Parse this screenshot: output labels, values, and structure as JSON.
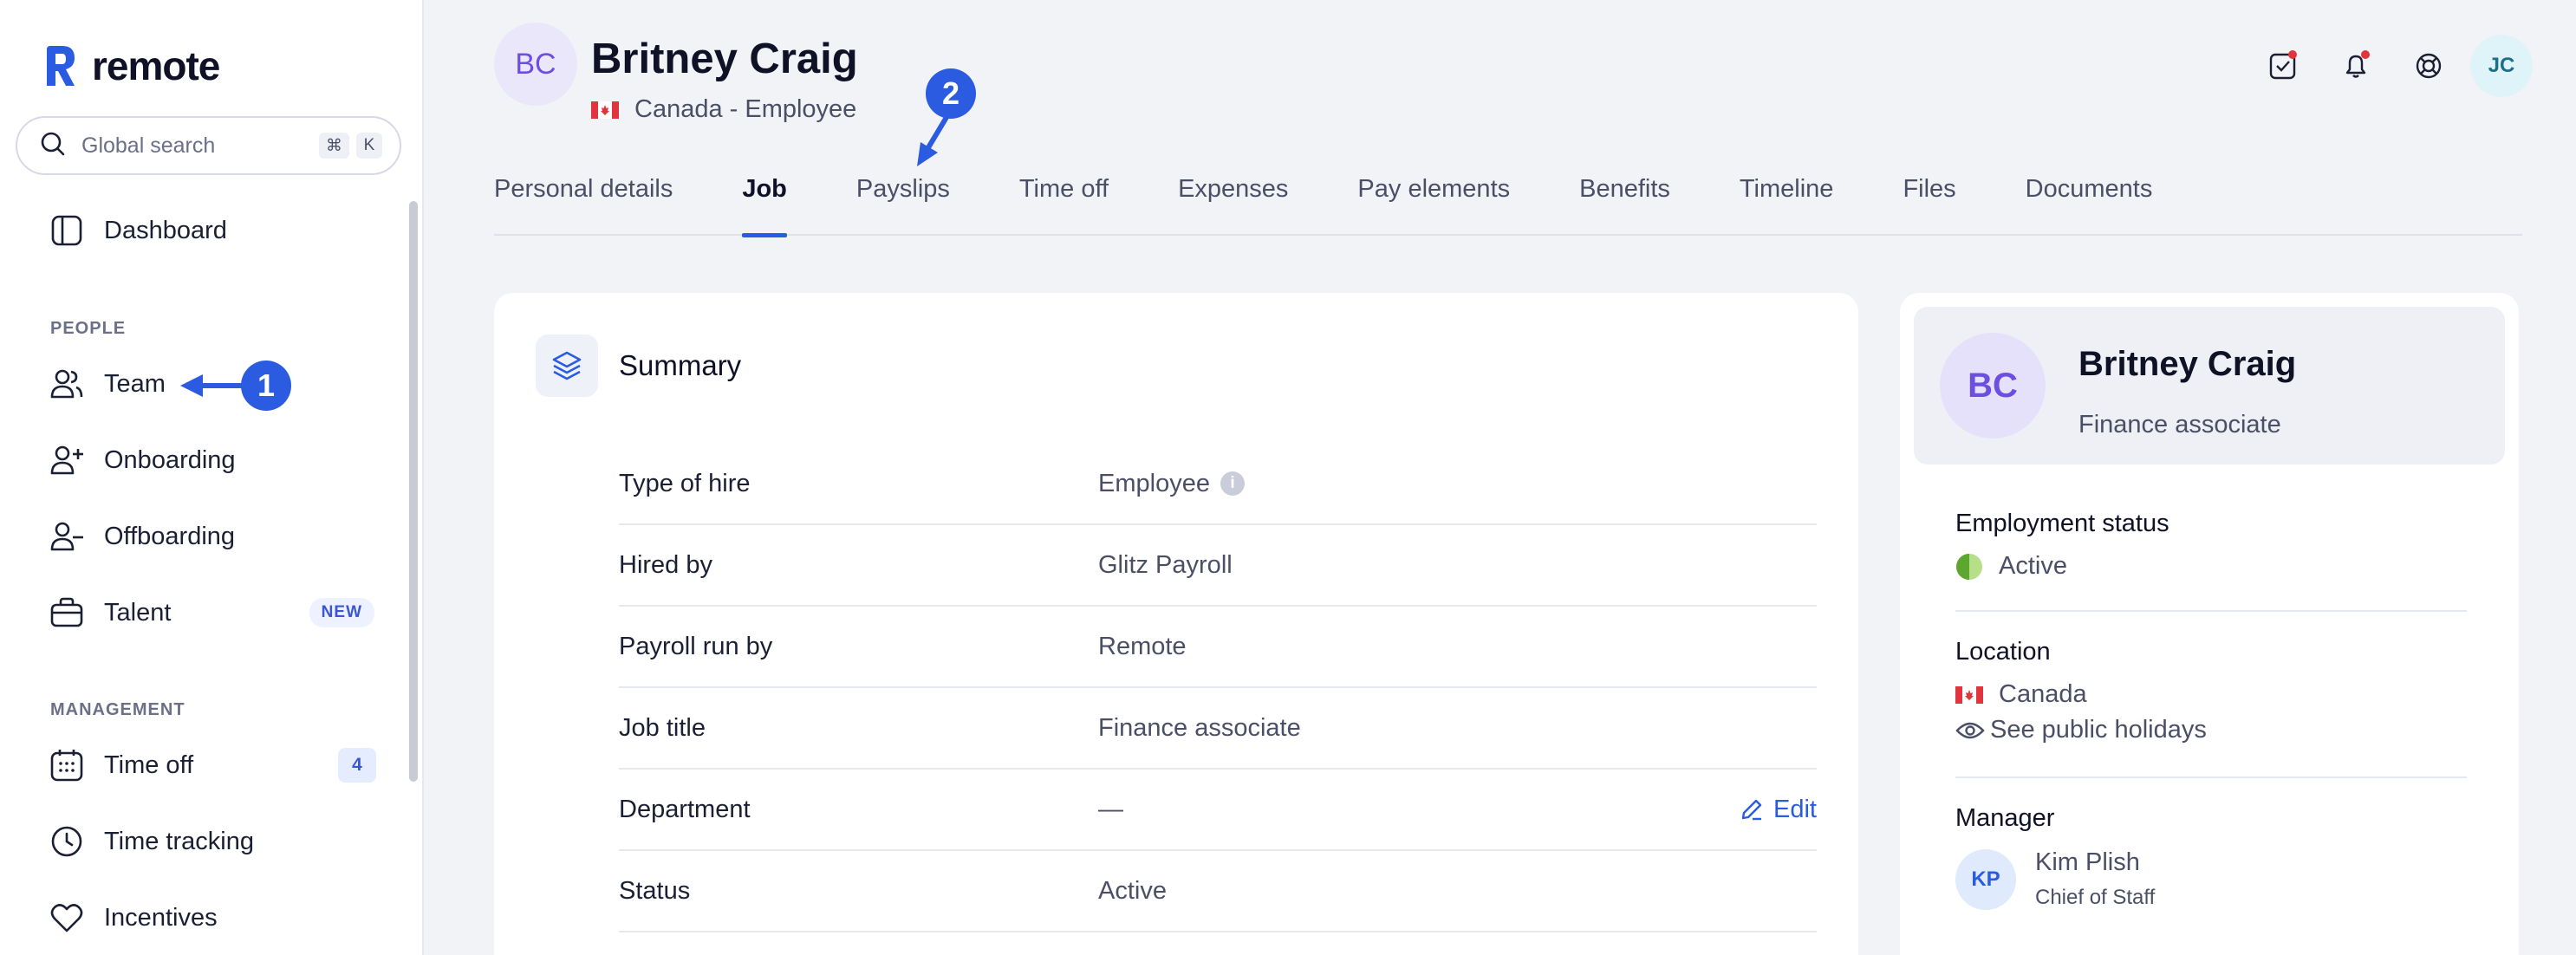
{
  "sidebar": {
    "logo_text": "remote",
    "search": {
      "placeholder": "Global search",
      "shortcut_cmd": "⌘",
      "shortcut_key": "K"
    },
    "dashboard_label": "Dashboard",
    "people_section": "PEOPLE",
    "team_label": "Team",
    "onboarding_label": "Onboarding",
    "offboarding_label": "Offboarding",
    "talent_label": "Talent",
    "talent_badge": "NEW",
    "management_section": "MANAGEMENT",
    "timeoff_label": "Time off",
    "timeoff_count": "4",
    "timetracking_label": "Time tracking",
    "incentives_label": "Incentives"
  },
  "markers": {
    "team": "1",
    "payslips": "2"
  },
  "header": {
    "initials": "BC",
    "name": "Britney Craig",
    "subtitle": "Canada - Employee",
    "user_initials": "JC"
  },
  "tabs": [
    {
      "label": "Personal details"
    },
    {
      "label": "Job",
      "active": true
    },
    {
      "label": "Payslips"
    },
    {
      "label": "Time off"
    },
    {
      "label": "Expenses"
    },
    {
      "label": "Pay elements"
    },
    {
      "label": "Benefits"
    },
    {
      "label": "Timeline"
    },
    {
      "label": "Files"
    },
    {
      "label": "Documents"
    }
  ],
  "summary": {
    "title": "Summary",
    "rows": [
      {
        "label": "Type of hire",
        "value": "Employee"
      },
      {
        "label": "Hired by",
        "value": "Glitz Payroll"
      },
      {
        "label": "Payroll run by",
        "value": "Remote"
      },
      {
        "label": "Job title",
        "value": "Finance associate"
      },
      {
        "label": "Department",
        "value": "—"
      },
      {
        "label": "Status",
        "value": "Active"
      }
    ],
    "edit_label": "Edit"
  },
  "profile": {
    "initials": "BC",
    "name": "Britney Craig",
    "role": "Finance associate",
    "employment_status_title": "Employment status",
    "employment_status": "Active",
    "location_title": "Location",
    "location": "Canada",
    "holidays_link": "See public holidays",
    "manager_title": "Manager",
    "manager_initials": "KP",
    "manager_name": "Kim Plish",
    "manager_role": "Chief of Staff"
  },
  "colors": {
    "accent": "#2a5be0",
    "status_active": "#7cc142",
    "flag_red": "#e0343e"
  }
}
